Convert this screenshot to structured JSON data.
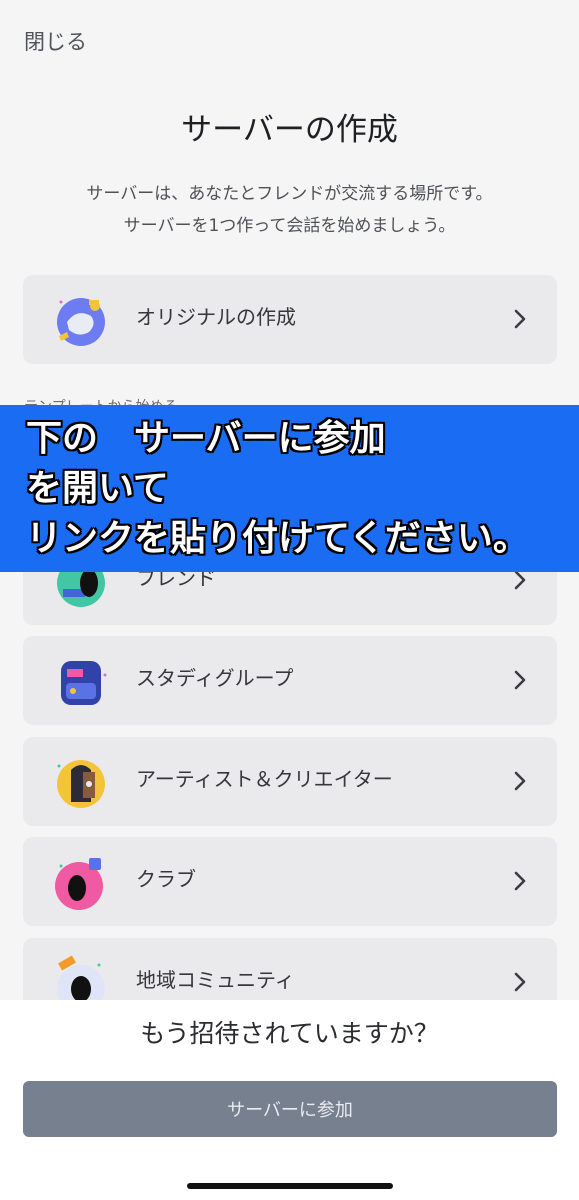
{
  "header": {
    "close_label": "閉じる",
    "title": "サーバーの作成"
  },
  "subtitle": {
    "line1": "サーバーは、あなたとフレンドが交流する場所です。",
    "line2": "サーバーを1つ作って会話を始めましょう。"
  },
  "create_own": {
    "label": "オリジナルの作成",
    "icon": "globe-icon"
  },
  "templates_section_label": "テンプレートから始める",
  "templates": [
    {
      "label": "フレンド",
      "icon": "friends-icon"
    },
    {
      "label": "スタディグループ",
      "icon": "backpack-icon"
    },
    {
      "label": "アーティスト＆クリエイター",
      "icon": "door-icon"
    },
    {
      "label": "クラブ",
      "icon": "club-icon"
    },
    {
      "label": "地域コミュニティ",
      "icon": "community-icon"
    }
  ],
  "banner": {
    "line1": "下の　サーバーに参加",
    "line2": "を開いて",
    "line3": "リンクを貼り付けてください。",
    "color": "#1a6cf2"
  },
  "footer": {
    "question": "もう招待されていますか？",
    "join_button": "サーバーに参加"
  }
}
